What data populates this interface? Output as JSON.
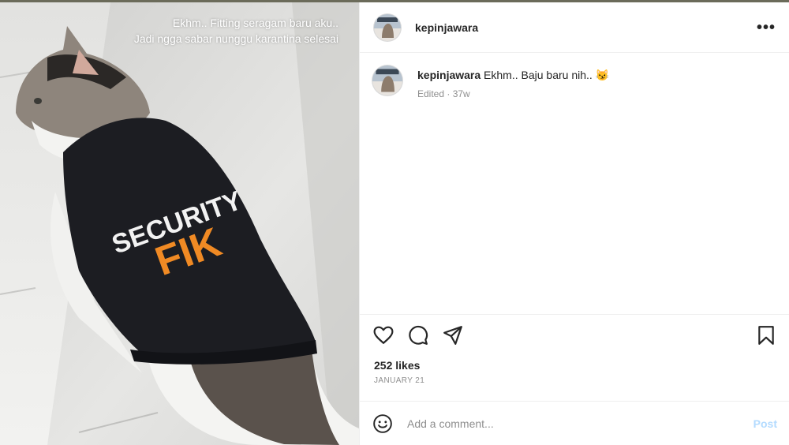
{
  "post": {
    "username": "kepinjawara",
    "more_label": "•••",
    "image_overlay_lines": [
      "Ekhm..  Fitting seragam baru aku..",
      "Jadi ngga sabar nunggu karantina selesai"
    ],
    "shirt_text": {
      "line1": "SECURITY",
      "line2": "FIK"
    },
    "caption": {
      "username": "kepinjawara",
      "text": "Ekhm.. Baju baru nih.. 😼",
      "meta": "Edited · 37w"
    },
    "likes": "252 likes",
    "date": "JANUARY 21",
    "comment": {
      "placeholder": "Add a comment...",
      "post_label": "Post",
      "emoji_icon": "smiley-icon"
    },
    "icons": [
      "heart-icon",
      "comment-icon",
      "share-icon",
      "bookmark-icon",
      "more-icon"
    ],
    "colors": {
      "post_button": "#b3dbff",
      "meta": "#8e8e8e",
      "shirt_orange": "#f08a24"
    }
  }
}
